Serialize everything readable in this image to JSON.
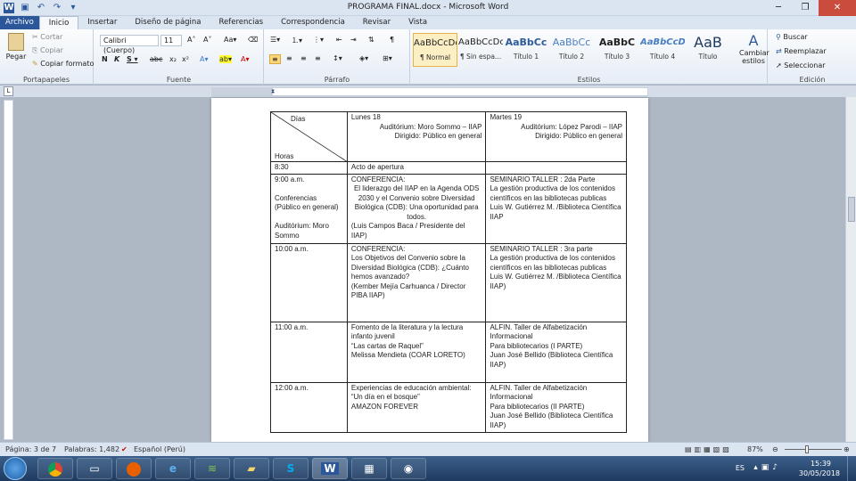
{
  "window": {
    "title": "PROGRAMA FINAL.docx - Microsoft Word"
  },
  "tabs": [
    "Archivo",
    "Inicio",
    "Insertar",
    "Diseño de página",
    "Referencias",
    "Correspondencia",
    "Revisar",
    "Vista"
  ],
  "clipboard": {
    "paste": "Pegar",
    "cut": "Cortar",
    "copy": "Copiar",
    "format": "Copiar formato",
    "label": "Portapapeles"
  },
  "font": {
    "name": "Calibri (Cuerpo)",
    "size": "11",
    "label": "Fuente"
  },
  "paragraph": {
    "label": "Párrafo"
  },
  "styles": {
    "label": "Estilos",
    "items": [
      {
        "preview": "AaBbCcDc",
        "name": "¶ Normal"
      },
      {
        "preview": "AaBbCcDc",
        "name": "¶ Sin espa..."
      },
      {
        "preview": "AaBbCc",
        "name": "Título 1"
      },
      {
        "preview": "AaBbCc",
        "name": "Título 2"
      },
      {
        "preview": "AaBbC",
        "name": "Título 3"
      },
      {
        "preview": "AaBbCcD",
        "name": "Título 4"
      },
      {
        "preview": "AaB",
        "name": "Título"
      }
    ],
    "change": "Cambiar estilos"
  },
  "editing": {
    "find": "Buscar",
    "replace": "Reemplazar",
    "select": "Seleccionar",
    "label": "Edición"
  },
  "table": {
    "header": {
      "days": "Días",
      "hours": "Horas",
      "day1": "Lunes 18",
      "day1_aud": "Auditórium: Moro Sommo – IIAP",
      "day1_dir": "Dirigido: Público en general",
      "day2": "Martes 19",
      "day2_aud": "Auditórium: López Parodi – IIAP",
      "day2_dir": "Dirigido: Público en general"
    },
    "rows": [
      {
        "time": "8:30",
        "c2": "Acto de apertura",
        "c3": ""
      },
      {
        "time": "9:00 a.m.",
        "extra1": "Conferencias (Público en general)",
        "extra2": "Auditórium: Moro Sommo",
        "c2a": "CONFERENCIA:",
        "c2b": "El liderazgo del IIAP en la Agenda ODS 2030 y el Convenio sobre Diversidad Biológica (CDB): Una oportunidad para todos.",
        "c2c": "(Luis Campos Baca / Presidente del IIAP)",
        "c3a": "SEMINARIO TALLER : 2da Parte",
        "c3b": "La gestión productiva de los contenidos científicos en las bibliotecas publicas",
        "c3c": "Luis W. Gutiérrez M. /Biblioteca Científica IIAP"
      },
      {
        "time": "10:00 a.m.",
        "c2a": "CONFERENCIA:",
        "c2b": "Los Objetivos del Convenio sobre la Diversidad Biológica (CDB): ¿Cuánto hemos avanzado?",
        "c2c": "(Kember Mejía Carhuanca / Director PIBA IIAP)",
        "c3a": "SEMINARIO TALLER : 3ra parte",
        "c3b": "La gestión productiva de los contenidos científicos en las bibliotecas publicas",
        "c3c": "Luis W. Gutiérrez M. /Biblioteca Científica IIAP)"
      },
      {
        "time": "11:00 a.m.",
        "c2a": "Fomento de la literatura y la lectura infanto juvenil",
        "c2b": "“Las cartas de Raquel”",
        "c2c": "Melissa Mendieta (COAR LORETO)",
        "c3a": "ALFIN. Taller de Alfabetización Informacional",
        "c3b": "Para bibliotecarios (I PARTE)",
        "c3c": "Juan José Bellido (Biblioteca Científica IIAP)"
      },
      {
        "time": "12:00 a.m.",
        "c2a": "Experiencias de educación ambiental:",
        "c2b": "“Un día en el bosque”",
        "c2c": "AMAZON FOREVER",
        "c3a": "ALFIN. Taller de Alfabetización Informacional",
        "c3b": "Para bibliotecarios (II PARTE)",
        "c3c": "Juan José Bellido (Biblioteca Científica IIAP)"
      }
    ]
  },
  "status": {
    "page": "Página: 3 de 7",
    "words": "Palabras: 1,482",
    "lang": "Español (Perú)",
    "zoom": "87%"
  },
  "tray": {
    "lang": "ES",
    "time": "15:39",
    "date": "30/05/2018"
  }
}
